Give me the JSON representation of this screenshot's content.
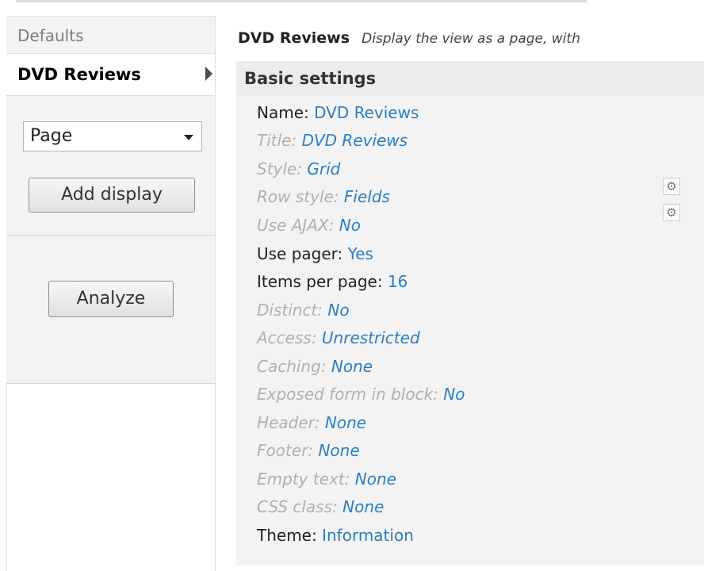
{
  "sidebar": {
    "tabs": [
      {
        "label": "Defaults"
      },
      {
        "label": "DVD Reviews"
      }
    ],
    "display_type_select": {
      "value": "Page"
    },
    "add_display_label": "Add display",
    "analyze_label": "Analyze"
  },
  "main": {
    "display_name": "DVD Reviews",
    "display_description": "Display the view as a page, with",
    "section_title": "Basic settings",
    "settings": [
      {
        "label": "Name:",
        "value": "DVD Reviews",
        "is_default": false
      },
      {
        "label": "Title:",
        "value": "DVD Reviews",
        "is_default": true
      },
      {
        "label": "Style:",
        "value": "Grid",
        "is_default": true
      },
      {
        "label": "Row style:",
        "value": "Fields",
        "is_default": true
      },
      {
        "label": "Use AJAX:",
        "value": "No",
        "is_default": true
      },
      {
        "label": "Use pager:",
        "value": "Yes",
        "is_default": false
      },
      {
        "label": "Items per page:",
        "value": "16",
        "is_default": false
      },
      {
        "label": "Distinct:",
        "value": "No",
        "is_default": true
      },
      {
        "label": "Access:",
        "value": "Unrestricted",
        "is_default": true
      },
      {
        "label": "Caching:",
        "value": "None",
        "is_default": true
      },
      {
        "label": "Exposed form in block:",
        "value": "No",
        "is_default": true
      },
      {
        "label": "Header:",
        "value": "None",
        "is_default": true
      },
      {
        "label": "Footer:",
        "value": "None",
        "is_default": true
      },
      {
        "label": "Empty text:",
        "value": "None",
        "is_default": true
      },
      {
        "label": "CSS class:",
        "value": "None",
        "is_default": true
      },
      {
        "label": "Theme:",
        "value": "Information",
        "is_default": false
      }
    ],
    "gear_icons": [
      "gear-icon",
      "gear-icon"
    ]
  },
  "colors": {
    "link": "#2a7fc1",
    "default_label": "#b0b0b0",
    "panel_bg": "#f3f3f3"
  }
}
